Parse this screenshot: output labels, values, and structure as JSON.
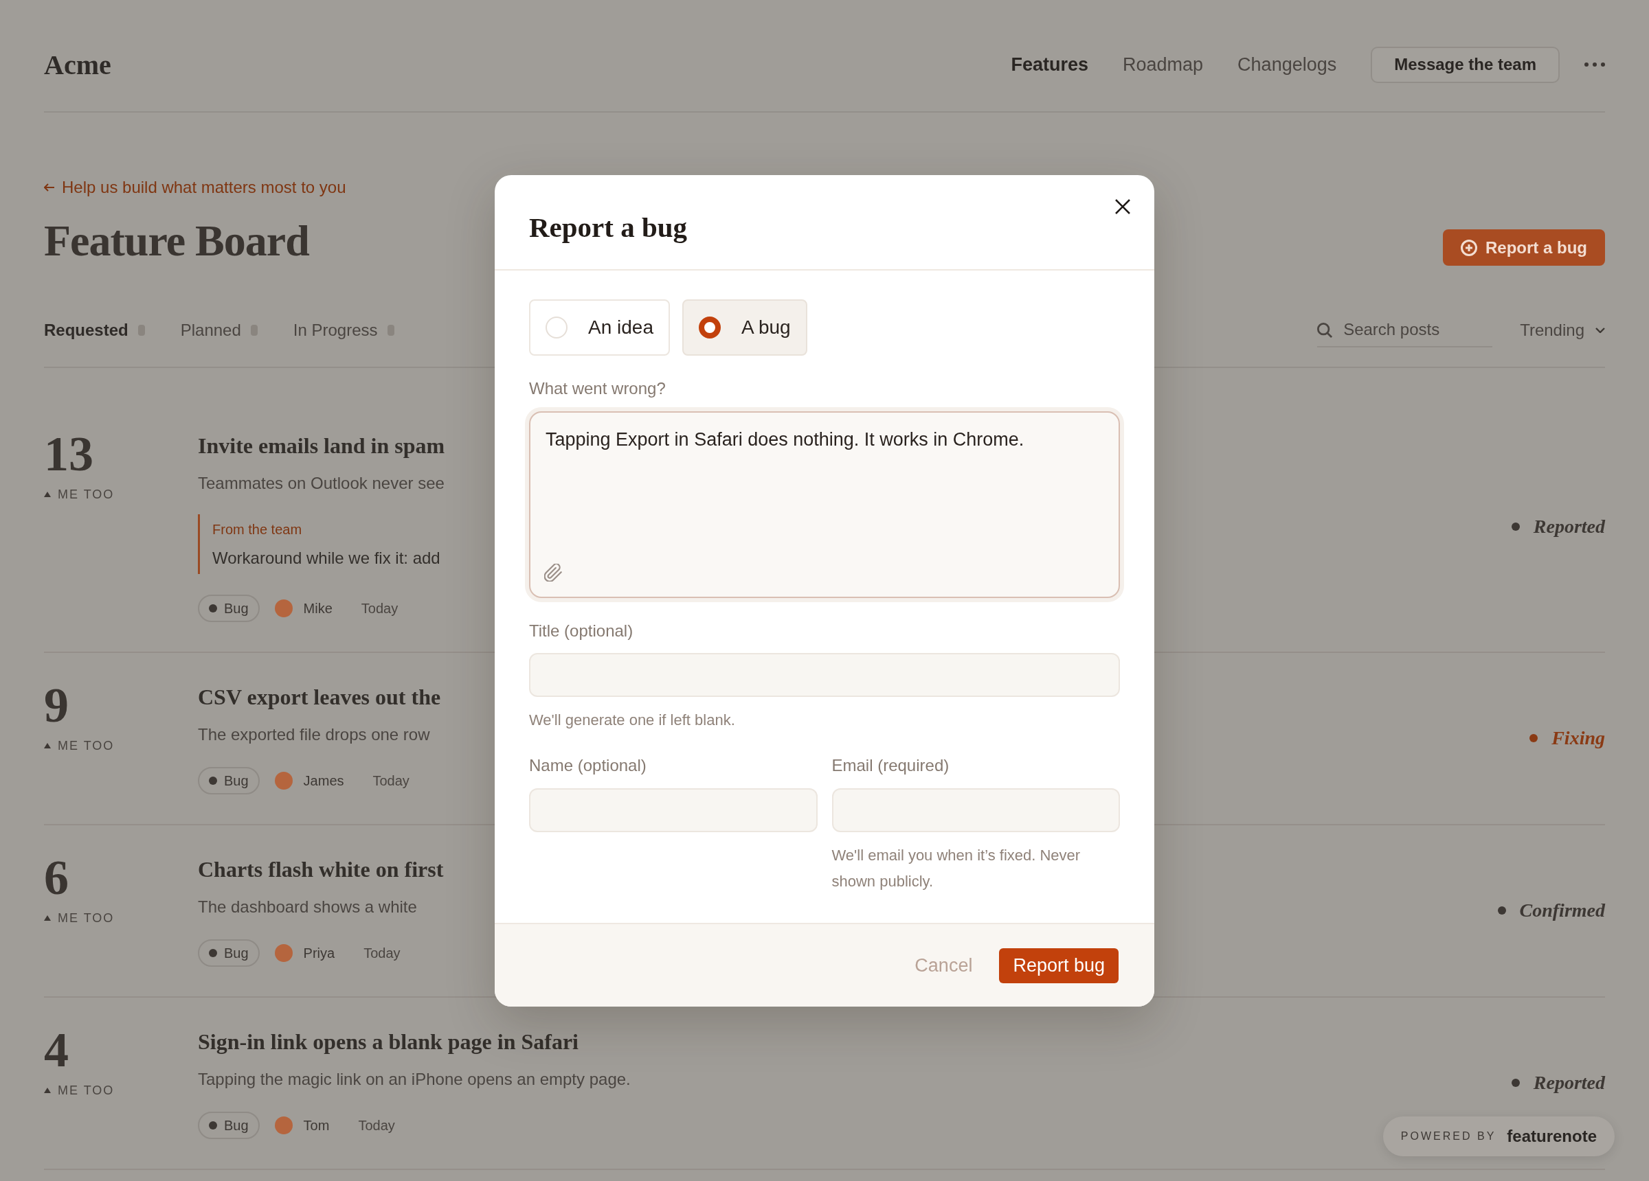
{
  "page": {
    "brand": "Acme",
    "nav": [
      {
        "label": "Features",
        "selected": true
      },
      {
        "label": "Roadmap",
        "selected": false
      },
      {
        "label": "Changelogs",
        "selected": false
      }
    ],
    "contact_button": "Message the team",
    "breadcrumb": "Help us build what matters most to you",
    "title": "Feature Board",
    "report_button": "Report a bug",
    "tabs": [
      {
        "label": "Requested",
        "selected": true
      },
      {
        "label": "Planned",
        "selected": false
      },
      {
        "label": "In Progress",
        "selected": false
      }
    ],
    "search": {
      "placeholder": "Search posts"
    },
    "sort": "Trending",
    "posts": [
      {
        "votes": "13",
        "vote_label": "ME TOO",
        "title": "Invite emails land in spam",
        "description": "Teammates on Outlook never see",
        "team_note": {
          "label": "From the team",
          "text": "Workaround while we fix it: add"
        },
        "tag": "Bug",
        "author": "Mike",
        "date": "Today",
        "status": "Reported",
        "color": "#3d3834"
      },
      {
        "votes": "9",
        "vote_label": "ME TOO",
        "title": "CSV export leaves out the",
        "description": "The exported file drops one row",
        "tag": "Bug",
        "author": "James",
        "date": "Today",
        "status": "Fixing",
        "color": "#8a3a14"
      },
      {
        "votes": "6",
        "vote_label": "ME TOO",
        "title": "Charts flash white on first",
        "description": "The dashboard shows a white",
        "tag": "Bug",
        "author": "Priya",
        "date": "Today",
        "status": "Confirmed",
        "color": "#3d3834"
      },
      {
        "votes": "4",
        "vote_label": "ME TOO",
        "title": "Sign-in link opens a blank page in Safari",
        "description": "Tapping the magic link on an iPhone opens an empty page.",
        "tag": "Bug",
        "author": "Tom",
        "date": "Today",
        "status": "Reported",
        "color": "#3d3834"
      }
    ],
    "powered_by": {
      "label": "POWERED BY",
      "brand": "featurenote"
    }
  },
  "dialog": {
    "title": "Report a bug",
    "type_options": [
      {
        "label": "An idea",
        "selected": false
      },
      {
        "label": "A bug",
        "selected": true
      }
    ],
    "description": {
      "label": "What went wrong?",
      "value": "Tapping Export in Safari does nothing. It works in Chrome.",
      "focused": true
    },
    "title_field": {
      "label": "Title (optional)",
      "hint": "We'll generate one if left blank."
    },
    "name_field": {
      "label": "Name (optional)"
    },
    "email_field": {
      "label": "Email (required)",
      "hint": "We'll email you when it’s fixed. Never shown publicly."
    },
    "buttons": [
      {
        "label": "Cancel",
        "kind": "secondary"
      },
      {
        "label": "Report bug",
        "kind": "primary"
      }
    ]
  }
}
